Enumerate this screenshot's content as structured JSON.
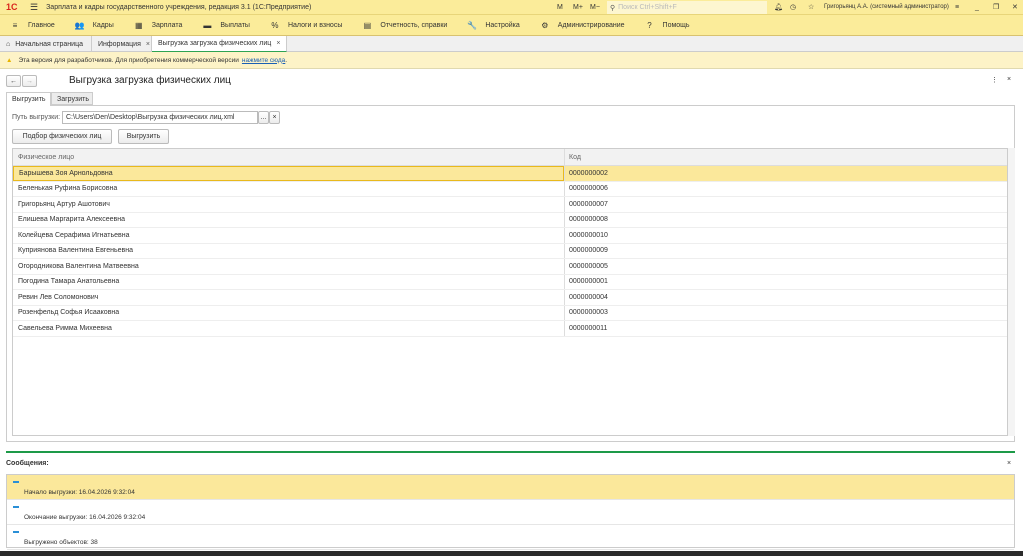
{
  "app": {
    "logo": "1С",
    "title": "Зарплата и кадры государственного учреждения, редакция 3.1  (1С:Предприятие)",
    "m": "M",
    "mplus": "M+",
    "mminus": "M−",
    "search_placeholder": "Поиск Ctrl+Shift+F",
    "user": "Григорьянц А.А. (системный администратор)"
  },
  "menu": [
    {
      "icon": "≡",
      "label": "Главное"
    },
    {
      "icon": "👥",
      "label": "Кадры"
    },
    {
      "icon": "▦",
      "label": "Зарплата"
    },
    {
      "icon": "▬",
      "label": "Выплаты"
    },
    {
      "icon": "%",
      "label": "Налоги и взносы"
    },
    {
      "icon": "▤",
      "label": "Отчетность, справки"
    },
    {
      "icon": "🔧",
      "label": "Настройка"
    },
    {
      "icon": "⚙",
      "label": "Администрирование"
    },
    {
      "icon": "?",
      "label": "Помощь"
    }
  ],
  "open_tabs": [
    {
      "label": "Начальная страница"
    },
    {
      "label": "Информация"
    },
    {
      "label": "Выгрузка загрузка физических лиц"
    }
  ],
  "warning": {
    "text": "Эта версия для разработчиков. Для приобретения коммерческой версии",
    "link": "нажмите сюда",
    "end": "."
  },
  "form": {
    "title": "Выгрузка загрузка физических лиц",
    "tabs": [
      "Выгрузить",
      "Загрузить"
    ],
    "path_label": "Путь выгрузки:",
    "path_value": "C:\\Users\\Den\\Desktop\\Выгрузка физических лиц.xml",
    "browse": "...",
    "clear": "×",
    "select_button": "Подбор физических лиц",
    "export_button": "Выгрузить"
  },
  "table": {
    "columns": [
      "Физическое лицо",
      "Код"
    ],
    "rows": [
      [
        "Барышева Зоя Арнольдовна",
        "0000000002"
      ],
      [
        "Беленькая Руфина Борисовна",
        "0000000006"
      ],
      [
        "Григорьянц Артур Ашотович",
        "0000000007"
      ],
      [
        "Елишева Маргарита Алексеевна",
        "0000000008"
      ],
      [
        "Колейцева Серафима Игнатьевна",
        "0000000010"
      ],
      [
        "Куприянова Валентина Евгеньевна",
        "0000000009"
      ],
      [
        "Огородникова Валентина Матвеевна",
        "0000000005"
      ],
      [
        "Погодина Тамара Анатольевна",
        "0000000001"
      ],
      [
        "Ревин Лев Соломонович",
        "0000000004"
      ],
      [
        "Розенфельд Софья Исааковна",
        "0000000003"
      ],
      [
        "Савельева Римма Михеевна",
        "0000000011"
      ]
    ]
  },
  "messages": {
    "title": "Сообщения:",
    "items": [
      "Начало выгрузки: 16.04.2026 9:32:04",
      "Окончание выгрузки: 16.04.2026 9:32:04",
      "Выгружено объектов: 38"
    ]
  }
}
